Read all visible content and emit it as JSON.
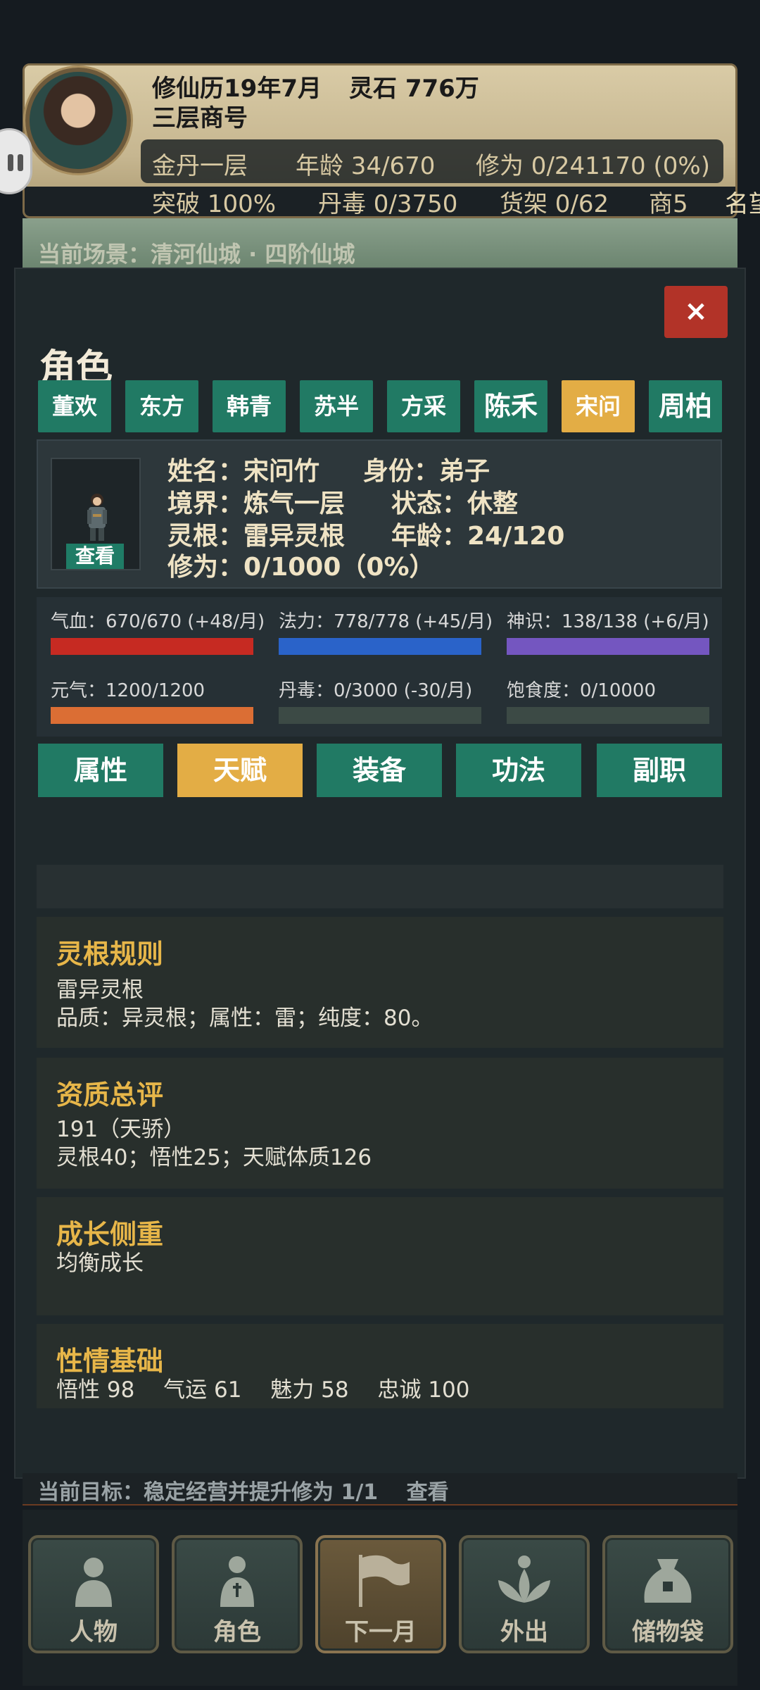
{
  "header": {
    "calendar": "修仙历19年7月",
    "spirit_stones": "灵石 776万",
    "shop_name": "三层商号",
    "realm": "金丹一层",
    "age": "年龄 34/670",
    "cultivation": "修为 0/241170 (0%)",
    "breakthrough": "突破 100%",
    "pill_toxin": "丹毒 0/3750",
    "shelf": "货架 0/62",
    "merchant": "商5",
    "fame": "名望"
  },
  "scene": {
    "text": "当前场景：清河仙城 · 四阶仙城"
  },
  "modal": {
    "title": "角色",
    "close_label": "×",
    "characters": [
      {
        "label": "董欢",
        "active": false
      },
      {
        "label": "东方",
        "active": false
      },
      {
        "label": "韩青",
        "active": false
      },
      {
        "label": "苏半",
        "active": false
      },
      {
        "label": "方采",
        "active": false
      },
      {
        "label": "陈禾",
        "active": false
      },
      {
        "label": "宋问",
        "active": true
      },
      {
        "label": "周柏",
        "active": false
      }
    ],
    "info": {
      "view_label": "查看",
      "name": "姓名：宋问竹",
      "identity": "身份：弟子",
      "realm": "境界：炼气一层",
      "status": "状态：休整",
      "root": "灵根：雷异灵根",
      "age": "年龄：24/120",
      "cultivation": "修为：0/1000（0%）"
    },
    "bars": [
      {
        "label": "气血：670/670 (+48/月)",
        "fraction": 1.0,
        "color": "#c62a22"
      },
      {
        "label": "法力：778/778 (+45/月)",
        "fraction": 1.0,
        "color": "#2a63c9"
      },
      {
        "label": "神识：138/138 (+6/月)",
        "fraction": 1.0,
        "color": "#7456c0"
      },
      {
        "label": "元气：1200/1200",
        "fraction": 1.0,
        "color": "#db6e34"
      },
      {
        "label": "丹毒：0/3000 (-30/月)",
        "fraction": 0.0,
        "color": "#3c4a45"
      },
      {
        "label": "饱食度：0/10000",
        "fraction": 0.0,
        "color": "#3c4a45"
      }
    ],
    "subtabs": [
      {
        "label": "属性",
        "active": false
      },
      {
        "label": "天赋",
        "active": true
      },
      {
        "label": "装备",
        "active": false
      },
      {
        "label": "功法",
        "active": false
      },
      {
        "label": "副职",
        "active": false
      }
    ],
    "sections": [
      {
        "title": "灵根规则",
        "lines": [
          "雷异灵根",
          "品质：异灵根；属性：雷；纯度：80。"
        ]
      },
      {
        "title": "资质总评",
        "lines": [
          "191（天骄）",
          "灵根40；悟性25；天赋体质126"
        ]
      },
      {
        "title": "成长侧重",
        "lines": [
          "均衡成长"
        ]
      },
      {
        "title": "性情基础",
        "lines": [
          "悟性 98　 气运 61　 魅力 58　 忠诚 100"
        ]
      }
    ]
  },
  "goal": {
    "text": "当前目标：稳定经营并提升修为 1/1　 查看"
  },
  "footer": {
    "buttons": [
      {
        "label": "人物",
        "icon": "person-icon"
      },
      {
        "label": "角色",
        "icon": "character-icon"
      },
      {
        "label": "下一月",
        "icon": "flag-icon"
      },
      {
        "label": "外出",
        "icon": "lotus-icon"
      },
      {
        "label": "储物袋",
        "icon": "bag-icon"
      }
    ]
  },
  "colors": {
    "accent_gold": "#e3ad45",
    "tab_green": "#217a64",
    "close_red": "#b23328",
    "section_title": "#e7b649"
  }
}
